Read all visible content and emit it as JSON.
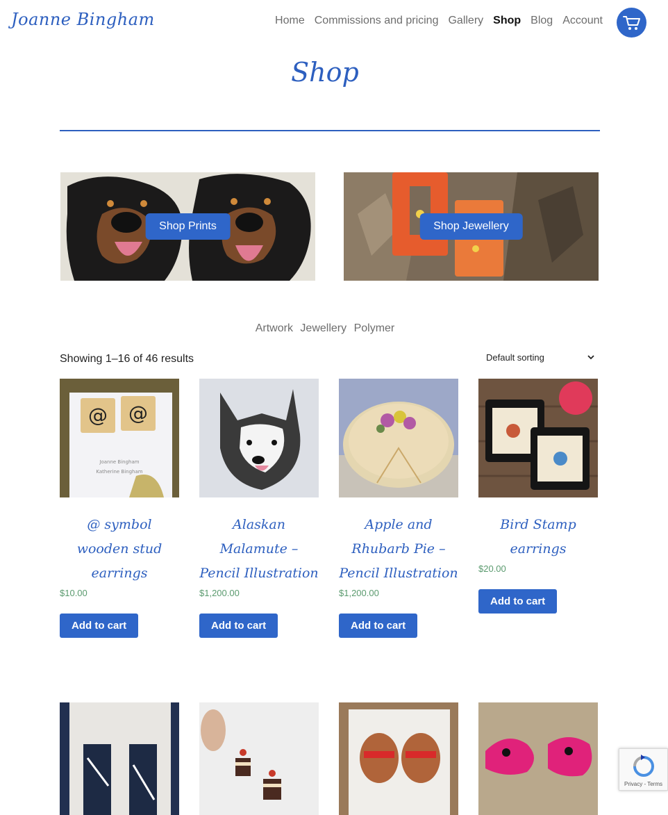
{
  "header": {
    "logo": "Joanne Bingham",
    "nav": [
      "Home",
      "Commissions and pricing",
      "Gallery",
      "Shop",
      "Blog",
      "Account"
    ],
    "active_nav": "Shop",
    "cart_icon": "shopping-cart-icon"
  },
  "page": {
    "title": "Shop"
  },
  "banners": [
    {
      "label": "Shop Prints"
    },
    {
      "label": "Shop Jewellery"
    }
  ],
  "categories": [
    "Artwork",
    "Jewellery",
    "Polymer"
  ],
  "results_text": "Showing 1–16 of 46 results",
  "sorting": {
    "selected": "Default sorting"
  },
  "products": [
    {
      "name": "@ symbol wooden stud earrings",
      "price": "$10.00",
      "button": "Add to cart"
    },
    {
      "name": "Alaskan Malamute – Pencil Illustration",
      "price": "$1,200.00",
      "button": "Add to cart"
    },
    {
      "name": "Apple and Rhubarb Pie – Pencil Illustration",
      "price": "$1,200.00",
      "button": "Add to cart"
    },
    {
      "name": "Bird Stamp earrings",
      "price": "$20.00",
      "button": "Add to cart"
    }
  ],
  "colors": {
    "accent": "#2f66c9",
    "price": "#5a9a6e",
    "nav": "#6d6d6d"
  },
  "recaptcha": {
    "links": "Privacy - Terms"
  }
}
